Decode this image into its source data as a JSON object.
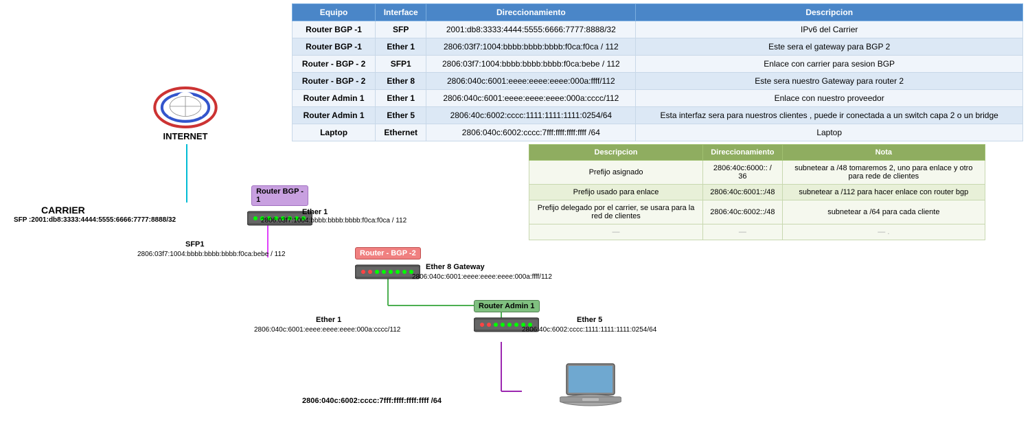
{
  "table": {
    "headers": [
      "Equipo",
      "Interface",
      "Direccionamiento",
      "Descripcion"
    ],
    "rows": [
      {
        "equipo": "Router BGP -1",
        "interface": "SFP",
        "direccionamiento": "2001:db8:3333:4444:5555:6666:7777:8888/32",
        "descripcion": "IPv6 del Carrier"
      },
      {
        "equipo": "Router BGP -1",
        "interface": "Ether 1",
        "direccionamiento": "2806:03f7:1004:bbbb:bbbb:bbbb:f0ca:f0ca / 112",
        "descripcion": "Este sera el gateway para BGP 2"
      },
      {
        "equipo": "Router - BGP - 2",
        "interface": "SFP1",
        "direccionamiento": "2806:03f7:1004:bbbb:bbbb:bbbb:f0ca:bebe / 112",
        "descripcion": "Enlace con carrier para sesion BGP"
      },
      {
        "equipo": "Router - BGP - 2",
        "interface": "Ether 8",
        "direccionamiento": "2806:040c:6001:eeee:eeee:eeee:000a:ffff/112",
        "descripcion": "Este sera nuestro Gateway para router 2"
      },
      {
        "equipo": "Router Admin 1",
        "interface": "Ether 1",
        "direccionamiento": "2806:040c:6001:eeee:eeee:eeee:000a:cccc/112",
        "descripcion": "Enlace con nuestro proveedor"
      },
      {
        "equipo": "Router Admin 1",
        "interface": "Ether 5",
        "direccionamiento": "2806:40c:6002:cccc:1111:1111:1111:0254/64",
        "descripcion": "Esta interfaz sera para nuestros clientes , puede ir conectada a un switch capa 2 o un bridge"
      },
      {
        "equipo": "Laptop",
        "interface": "Ethernet",
        "direccionamiento": "2806:040c:6002:cccc:7fff:ffff:ffff:ffff /64",
        "descripcion": "Laptop"
      }
    ]
  },
  "second_table": {
    "headers": [
      "Descripcion",
      "Direccionamiento",
      "Nota"
    ],
    "rows": [
      {
        "desc": "Prefijo asignado",
        "dir": "2806:40c:6000:: / 36",
        "nota": "subnetear a /48  tomaremos 2, uno para enlace y otro para rede de clientes"
      },
      {
        "desc": "Prefijo usado para enlace",
        "dir": "2806:40c:6001::/48",
        "nota": "subnetear a /112 para hacer enlace con router bgp"
      },
      {
        "desc": "Prefijo delegado por el carrier, se usara para la red de clientes",
        "dir": "2806:40c:6002::/48",
        "nota": "subnetear a /64 para cada cliente"
      },
      {
        "desc": "—",
        "dir": "—",
        "nota": "—  ."
      }
    ]
  },
  "diagram": {
    "internet_label": "INTERNET",
    "carrier_label": "CARRIER",
    "carrier_sfp": "SFP :2001:db8:3333:4444:5555:6666:7777:8888/32",
    "router_bgp1_label": "Router BGP -\n1",
    "router_bgp1_ether1": "Ether 1",
    "router_bgp1_addr": "2806:03f7:1004:bbbb:bbbb:bbbb:f0ca:f0ca / 112",
    "router_bgp2_label": "Router - BGP -2",
    "router_bgp2_sfp1": "SFP1",
    "router_bgp2_addr": "2806:03f7:1004:bbbb:bbbb:bbbb:f0ca:bebe / 112",
    "router_bgp2_ether8": "Ether 8 Gateway",
    "router_bgp2_addr2": "2806:040c:6001:eeee:eeee:eeee:000a:ffff/112",
    "router_admin1_label": "Router Admin 1",
    "router_admin1_ether1": "Ether 1",
    "router_admin1_addr1": "2806:040c:6001:eeee:eeee:eeee:000a:cccc/112",
    "router_admin1_ether5": "Ether 5",
    "router_admin1_addr2": "2806:40c:6002:cccc:1111:1111:1111:0254/64",
    "laptop_addr": "2806:040c:6002:cccc:7fff:ffff:ffff:ffff /64"
  }
}
